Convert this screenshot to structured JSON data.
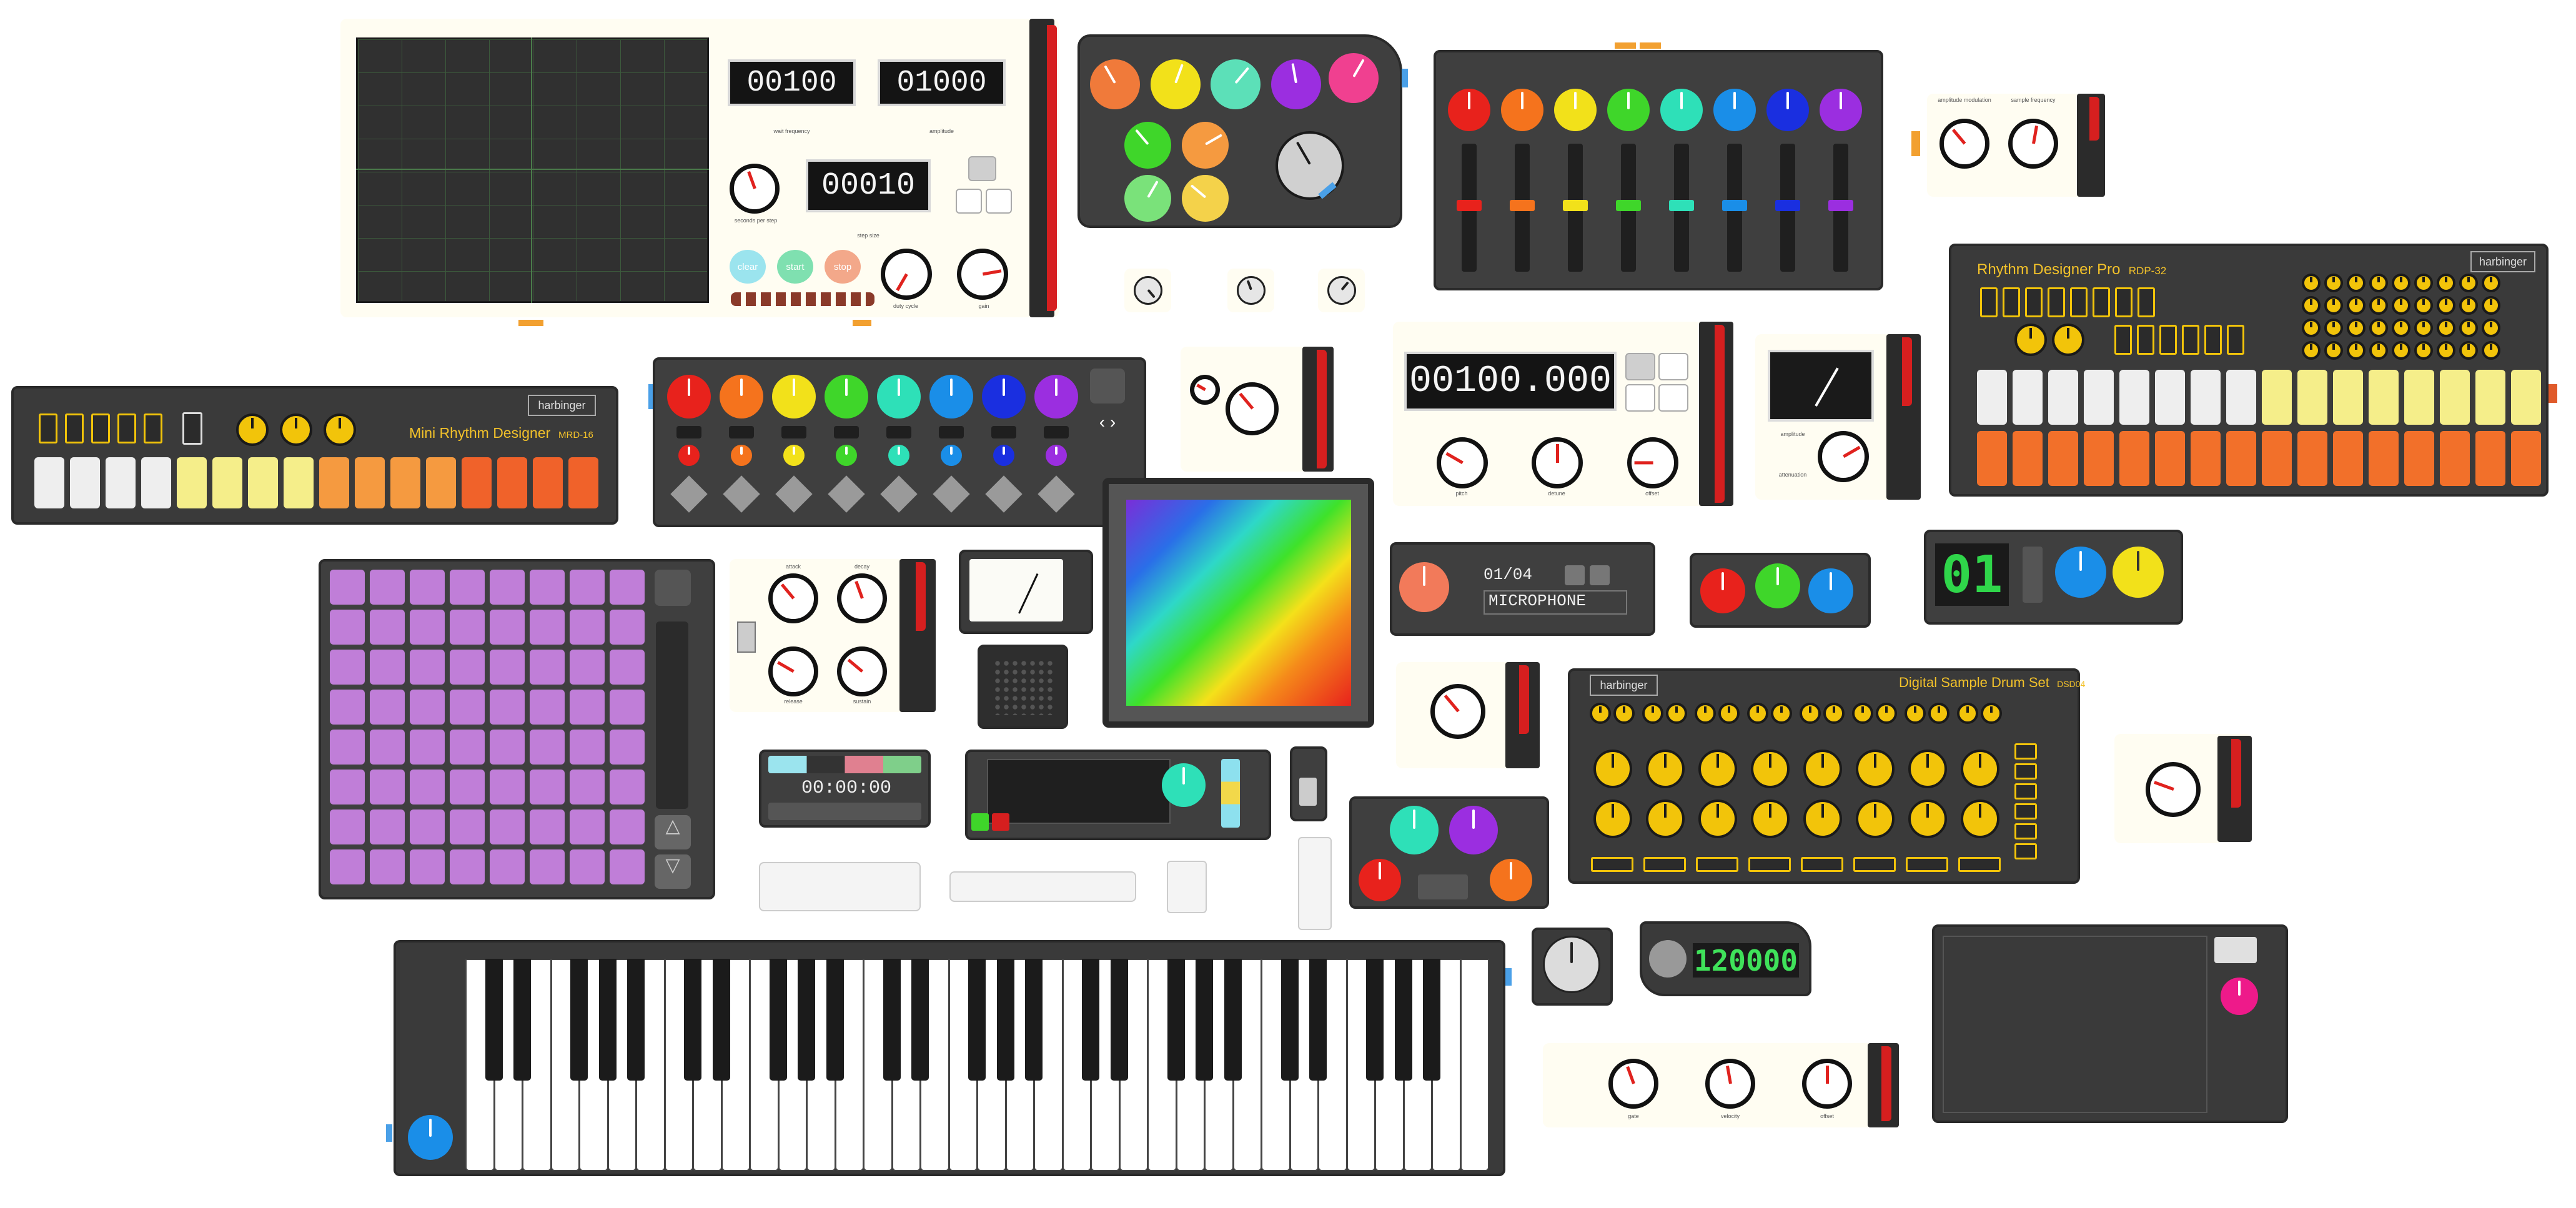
{
  "scope": {
    "freq_value": "00100",
    "freq_label": "wait frequency",
    "amp_value": "01000",
    "amp_label": "amplitude",
    "step_value": "00010",
    "step_label": "step size",
    "time_label": "seconds per step",
    "duty_label": "duty cycle",
    "gain_label": "gain",
    "btn_clear": "clear",
    "btn_start": "start",
    "btn_stop": "stop"
  },
  "mini_rhythm": {
    "brand": "harbinger",
    "title": "Mini Rhythm Designer",
    "model": "MRD-16"
  },
  "rhythm_pro": {
    "brand": "harbinger",
    "title": "Rhythm Designer Pro",
    "model": "RDP-32"
  },
  "drum_set": {
    "brand": "harbinger",
    "title": "Digital Sample Drum Set",
    "model": "DSD04"
  },
  "osc_big": {
    "value": "00100.000",
    "knob_labels": [
      "pitch",
      "detune",
      "offset"
    ]
  },
  "mic_module": {
    "track": "01/04",
    "source": "MICROPHONE"
  },
  "step_counter": {
    "value": "01"
  },
  "transport": {
    "time": "00:00:00"
  },
  "tempo": {
    "value": "120000"
  },
  "lfo_small": {
    "labels": [
      "amplitude modulation",
      "sample frequency"
    ]
  },
  "env": {
    "labels": [
      "attack",
      "decay",
      "release",
      "sustain"
    ]
  },
  "vu": {
    "label_a": "amplitude",
    "label_b": "attenuation"
  },
  "seq_bottom": {
    "labels": [
      "gate",
      "velocity",
      "offset"
    ]
  },
  "keyboard": {
    "white_keys": 36
  },
  "colors": {
    "red": "#e8221c",
    "orange": "#f5731d",
    "yellow": "#f2e11a",
    "green": "#3fd62a",
    "teal": "#2ee0b8",
    "blue": "#1a8ee8",
    "navy": "#1a2fe0",
    "purple": "#9b2ee0",
    "pad_purple": "#c07ed8",
    "accent_red": "#d61f1f"
  }
}
